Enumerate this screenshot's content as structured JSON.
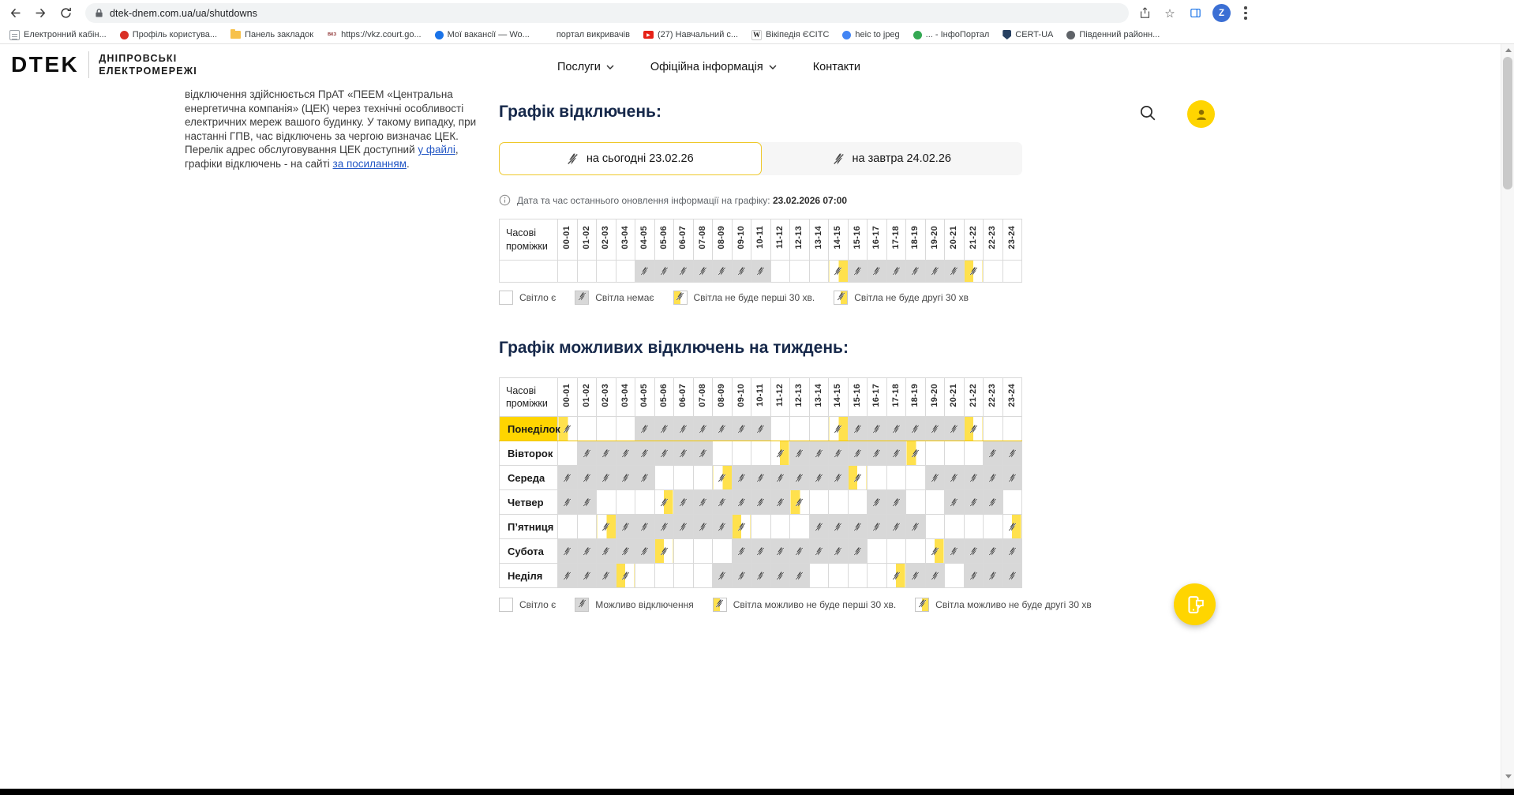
{
  "browser": {
    "url": "dtek-dnem.com.ua/ua/shutdowns",
    "avatar_letter": "Z",
    "bookmarks": [
      {
        "label": "Електронний кабін...",
        "icon": "document"
      },
      {
        "label": "Профіль користува...",
        "icon": "red"
      },
      {
        "label": "Панель закладок",
        "icon": "folder"
      },
      {
        "label": "https://vkz.court.go...",
        "icon": "court"
      },
      {
        "label": "Мої вакансії — Wo...",
        "icon": "blue"
      },
      {
        "label": "портал викривачів",
        "icon": "flag"
      },
      {
        "label": "(27) Навчальний с...",
        "icon": "youtube"
      },
      {
        "label": "Вікіпедія ЄСІТС",
        "icon": "wikipedia"
      },
      {
        "label": "heic to jpeg",
        "icon": "ribbon"
      },
      {
        "label": "... - ІнфоПортал",
        "icon": "globe"
      },
      {
        "label": "CERT-UA",
        "icon": "shield"
      },
      {
        "label": "Південний районн...",
        "icon": "building"
      }
    ]
  },
  "icons": {
    "no_power": "crossed-lightning-bolt",
    "search": "magnifier",
    "account": "person",
    "info": "info-circle",
    "lock": "padlock",
    "fab": "chat-with-phone"
  },
  "site_header": {
    "logo_main": "DTEK",
    "logo_line1": "ДНІПРОВСЬКІ",
    "logo_line2": "ЕЛЕКТРОМЕРЕЖІ",
    "nav": [
      {
        "label": "Послуги",
        "has_dropdown": true
      },
      {
        "label": "Офіційна інформація",
        "has_dropdown": true
      },
      {
        "label": "Контакти",
        "has_dropdown": false
      }
    ]
  },
  "article": {
    "text_before_link1": "відключення здійснюється ПрАТ «ПЕЕМ «Центральна енергетична компанія» (ЦЕК) через технічні особливості електричних мереж вашого будинку. У такому випадку, при настанні ГПВ, час відключень за чергою визначає ЦЕК. Перелік адрес обслуговування ЦЕК доступний ",
    "link_file": "у файлі",
    "text_between": ", графіки відключень - на сайті ",
    "link_site": "за посиланням",
    "text_after": "."
  },
  "shutdowns": {
    "title": "Графік відключень:",
    "tabs": [
      {
        "label": "на сьогодні 23.02.26",
        "active": true
      },
      {
        "label": "на завтра 24.02.26",
        "active": false
      }
    ],
    "updated_label": "Дата та час останнього оновлення інформації на графіку: ",
    "updated_value": "23.02.2026 07:00",
    "corner_label": "Часові проміжки",
    "time_slots": [
      "00-01",
      "01-02",
      "02-03",
      "03-04",
      "04-05",
      "05-06",
      "06-07",
      "07-08",
      "08-09",
      "09-10",
      "10-11",
      "11-12",
      "12-13",
      "13-14",
      "14-15",
      "15-16",
      "16-17",
      "17-18",
      "18-19",
      "19-20",
      "20-21",
      "21-22",
      "22-23",
      "23-24"
    ],
    "today": [
      "",
      "",
      "",
      "",
      "X",
      "X",
      "X",
      "X",
      "X",
      "X",
      "X",
      "",
      "",
      "",
      "2",
      "X",
      "X",
      "X",
      "X",
      "X",
      "X",
      "1",
      "",
      ""
    ],
    "legend": [
      {
        "state": "on",
        "label": "Світло є"
      },
      {
        "state": "off",
        "label": "Світла немає"
      },
      {
        "state": "first",
        "label": "Світла не буде перші 30 хв."
      },
      {
        "state": "second",
        "label": "Світла не буде другі 30 хв"
      }
    ]
  },
  "weekly": {
    "title": "Графік можливих відключень на тиждень:",
    "corner_label": "Часові проміжки",
    "days": [
      {
        "label": "Понеділок",
        "active": true,
        "cells": [
          "1",
          "",
          "",
          "",
          "X",
          "X",
          "X",
          "X",
          "X",
          "X",
          "X",
          "",
          "",
          "",
          "2",
          "X",
          "X",
          "X",
          "X",
          "X",
          "X",
          "1",
          "",
          ""
        ]
      },
      {
        "label": "Вівторок",
        "active": false,
        "cells": [
          "",
          "X",
          "X",
          "X",
          "X",
          "X",
          "X",
          "X",
          "",
          "",
          "",
          "2",
          "X",
          "X",
          "X",
          "X",
          "X",
          "X",
          "1",
          "",
          "",
          "",
          "X",
          "X"
        ]
      },
      {
        "label": "Середа",
        "active": false,
        "cells": [
          "X",
          "X",
          "X",
          "X",
          "X",
          "",
          "",
          "",
          "2",
          "X",
          "X",
          "X",
          "X",
          "X",
          "X",
          "1",
          "",
          "",
          "",
          "X",
          "X",
          "X",
          "X",
          "X"
        ]
      },
      {
        "label": "Четвер",
        "active": false,
        "cells": [
          "X",
          "X",
          "",
          "",
          "",
          "2",
          "X",
          "X",
          "X",
          "X",
          "X",
          "X",
          "1",
          "",
          "",
          "",
          "X",
          "X",
          "",
          "",
          "X",
          "X",
          "X",
          ""
        ]
      },
      {
        "label": "П’ятниця",
        "active": false,
        "cells": [
          "",
          "",
          "2",
          "X",
          "X",
          "X",
          "X",
          "X",
          "X",
          "1",
          "",
          "",
          "",
          "X",
          "X",
          "X",
          "X",
          "X",
          "X",
          "",
          "",
          "",
          "",
          "2"
        ]
      },
      {
        "label": "Субота",
        "active": false,
        "cells": [
          "X",
          "X",
          "X",
          "X",
          "X",
          "1",
          "",
          "",
          "",
          "X",
          "X",
          "X",
          "X",
          "X",
          "X",
          "X",
          "",
          "",
          "",
          "2",
          "X",
          "X",
          "X",
          "X"
        ]
      },
      {
        "label": "Неділя",
        "active": false,
        "cells": [
          "X",
          "X",
          "X",
          "1",
          "",
          "",
          "",
          "",
          "X",
          "X",
          "X",
          "X",
          "X",
          "",
          "",
          "",
          "",
          "2",
          "X",
          "X",
          "",
          "X",
          "X",
          "X"
        ]
      }
    ],
    "legend": [
      {
        "state": "on",
        "label": "Світло є"
      },
      {
        "state": "off",
        "label": "Можливо відключення"
      },
      {
        "state": "first",
        "label": "Світла можливо не буде перші 30 хв."
      },
      {
        "state": "second",
        "label": "Світла можливо не буде другі 30 хв"
      }
    ]
  },
  "colors": {
    "accent_yellow": "#ffd500",
    "cell_off_gray": "#d8d8d8",
    "half_hour_yellow": "#ffe14d",
    "heading_navy": "#16284a",
    "link_blue": "#2357c5"
  }
}
